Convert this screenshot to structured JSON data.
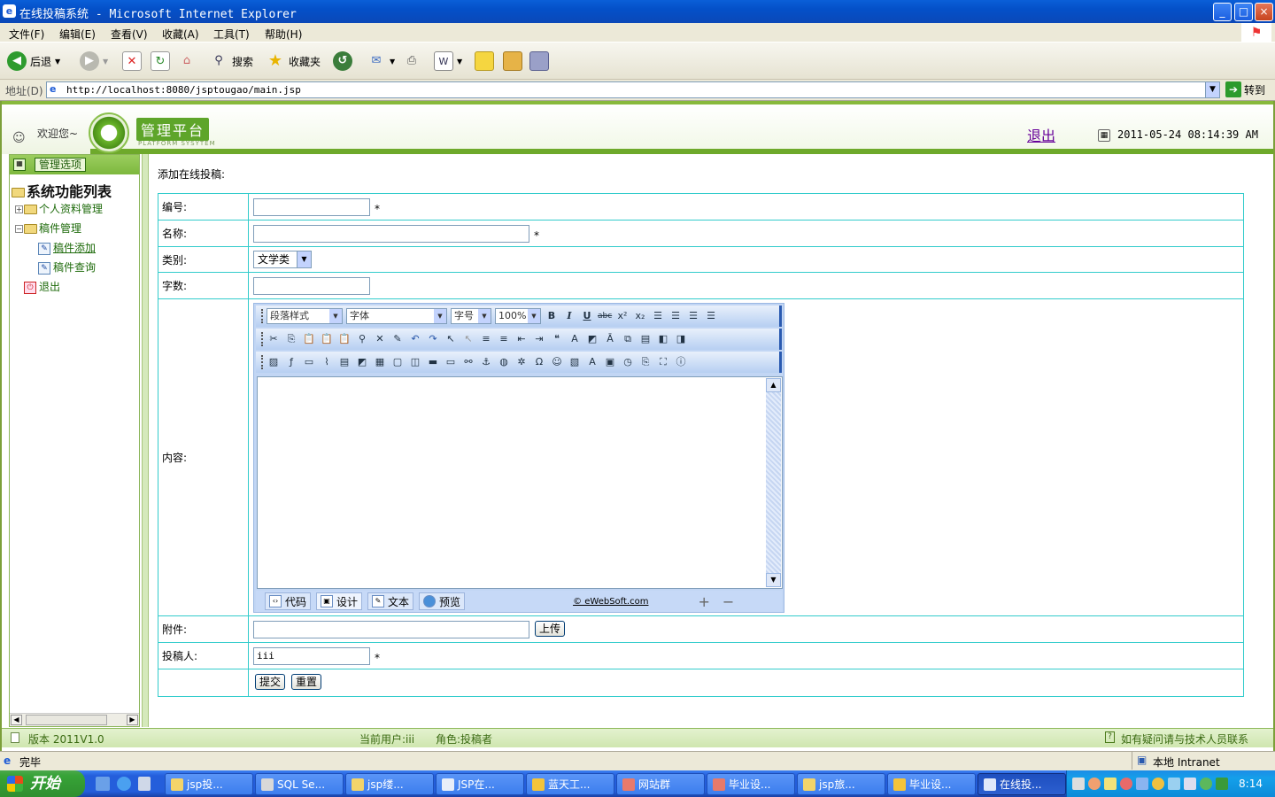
{
  "window": {
    "title": "在线投稿系统 - Microsoft Internet Explorer",
    "min": "_",
    "max": "□",
    "close": "×"
  },
  "menu": [
    "文件(F)",
    "编辑(E)",
    "查看(V)",
    "收藏(A)",
    "工具(T)",
    "帮助(H)"
  ],
  "toolbar": {
    "back": "后退",
    "search": "搜索",
    "favorites": "收藏夹"
  },
  "address": {
    "label": "地址(D)",
    "url": "http://localhost:8080/jsptougao/main.jsp",
    "go": "转到"
  },
  "header": {
    "welcome": "欢迎您~",
    "logo_title": "管理平台",
    "logo_sub": "PLATFORM SYSYTEM",
    "logout": "退出",
    "datetime": "2011-05-24 08:14:39 AM"
  },
  "sidebar": {
    "head": "管理选项",
    "root": "系统功能列表",
    "items": [
      {
        "label": "个人资料管理"
      },
      {
        "label": "稿件管理"
      },
      {
        "label": "稿件添加"
      },
      {
        "label": "稿件查询"
      },
      {
        "label": "退出"
      }
    ]
  },
  "form": {
    "title": "添加在线投稿:",
    "fields": {
      "number": {
        "label": "编号:",
        "value": ""
      },
      "name": {
        "label": "名称:",
        "value": ""
      },
      "category": {
        "label": "类别:",
        "value": "文学类"
      },
      "words": {
        "label": "字数:",
        "value": ""
      },
      "content": {
        "label": "内容:"
      },
      "attachment": {
        "label": "附件:",
        "value": "",
        "upload": "上传"
      },
      "author": {
        "label": "投稿人:",
        "value": "iii"
      }
    },
    "required_mark": "*",
    "submit": "提交",
    "reset": "重置"
  },
  "editor": {
    "paragraph": "段落样式",
    "font": "字体",
    "size": "字号",
    "zoom": "100%",
    "tabs": [
      "代码",
      "设计",
      "文本",
      "预览"
    ],
    "credit": "© eWebSoft.com"
  },
  "page_status": {
    "version": "版本 2011V1.0",
    "user": "当前用户:iii",
    "role": "角色:投稿者",
    "help": "如有疑问请与技术人员联系"
  },
  "ie_status": {
    "done": "完毕",
    "zone": "本地 Intranet"
  },
  "taskbar": {
    "start": "开始",
    "tasks": [
      "jsp投...",
      "SQL Se...",
      "jsp缕...",
      "JSP在...",
      "蓝天工...",
      "网站群",
      "毕业设...",
      "jsp旅...",
      "毕业设...",
      "在线投..."
    ],
    "time": "8:14"
  }
}
